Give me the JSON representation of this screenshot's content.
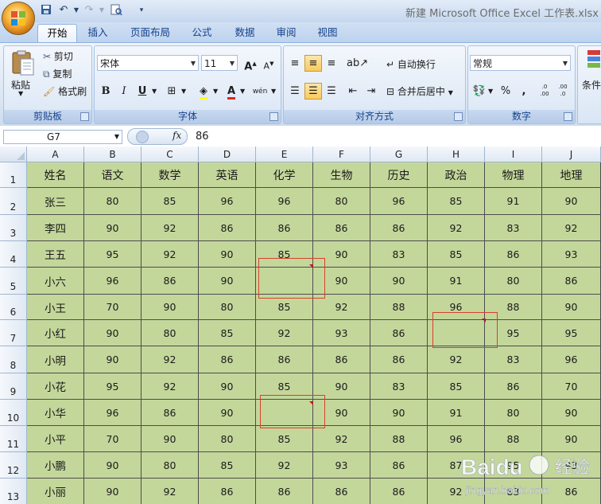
{
  "window": {
    "title": "新建 Microsoft Office Excel 工作表.xlsx"
  },
  "tabs": [
    {
      "label": "开始",
      "active": true
    },
    {
      "label": "插入",
      "active": false
    },
    {
      "label": "页面布局",
      "active": false
    },
    {
      "label": "公式",
      "active": false
    },
    {
      "label": "数据",
      "active": false
    },
    {
      "label": "审阅",
      "active": false
    },
    {
      "label": "视图",
      "active": false
    }
  ],
  "ribbon": {
    "clipboard": {
      "label": "剪贴板",
      "paste": "粘贴",
      "cut": "剪切",
      "copy": "复制",
      "format_painter": "格式刷"
    },
    "font": {
      "label": "字体",
      "font_name": "宋体",
      "font_size": "11",
      "bold": "B",
      "italic": "I",
      "underline": "U",
      "grow": "A",
      "shrink": "A",
      "font_color_glyph": "A",
      "phonetic": "wén"
    },
    "alignment": {
      "label": "对齐方式",
      "wrap_text": "自动换行",
      "merge_center": "合并后居中"
    },
    "number": {
      "label": "数字",
      "format": "常规",
      "percent": "%",
      "comma": ",",
      "inc_decimal": ".0\n.00",
      "dec_decimal": ".00\n.0"
    },
    "styles": {
      "label_partial": "条件"
    }
  },
  "formula_bar": {
    "name_box": "G7",
    "fx": "fx",
    "value": "86"
  },
  "sheet": {
    "columns": [
      "A",
      "B",
      "C",
      "D",
      "E",
      "F",
      "G",
      "H",
      "I",
      "J"
    ],
    "rows": [
      "1",
      "2",
      "3",
      "4",
      "5",
      "6",
      "7",
      "8",
      "9",
      "10",
      "11",
      "12",
      "13"
    ],
    "data": [
      [
        "姓名",
        "语文",
        "数学",
        "英语",
        "化学",
        "生物",
        "历史",
        "政治",
        "物理",
        "地理"
      ],
      [
        "张三",
        "80",
        "85",
        "96",
        "96",
        "80",
        "96",
        "85",
        "91",
        "90"
      ],
      [
        "李四",
        "90",
        "92",
        "86",
        "86",
        "86",
        "86",
        "92",
        "83",
        "92"
      ],
      [
        "王五",
        "95",
        "92",
        "90",
        "85",
        "90",
        "83",
        "85",
        "86",
        "93"
      ],
      [
        "小六",
        "96",
        "86",
        "90",
        "",
        "90",
        "90",
        "91",
        "80",
        "86"
      ],
      [
        "小王",
        "70",
        "90",
        "80",
        "85",
        "92",
        "88",
        "96",
        "88",
        "90"
      ],
      [
        "小红",
        "90",
        "80",
        "85",
        "92",
        "93",
        "86",
        "",
        "95",
        "95"
      ],
      [
        "小明",
        "90",
        "92",
        "86",
        "86",
        "86",
        "86",
        "92",
        "83",
        "96"
      ],
      [
        "小花",
        "95",
        "92",
        "90",
        "85",
        "90",
        "83",
        "85",
        "86",
        "70"
      ],
      [
        "小华",
        "96",
        "86",
        "90",
        "",
        "90",
        "90",
        "91",
        "80",
        "90"
      ],
      [
        "小平",
        "70",
        "90",
        "80",
        "85",
        "92",
        "88",
        "96",
        "88",
        "90"
      ],
      [
        "小鹏",
        "90",
        "80",
        "85",
        "92",
        "93",
        "86",
        "87",
        "95",
        "93"
      ],
      [
        "小丽",
        "90",
        "92",
        "86",
        "86",
        "86",
        "86",
        "92",
        "83",
        "86"
      ]
    ]
  },
  "watermark": {
    "brand": "Baidu",
    "cn": "经验",
    "url": "jingyan.baidu.com"
  },
  "colors": {
    "cell_fill": "#c4d79b",
    "highlight_border": "#d9402a",
    "accent": "#15428b"
  }
}
